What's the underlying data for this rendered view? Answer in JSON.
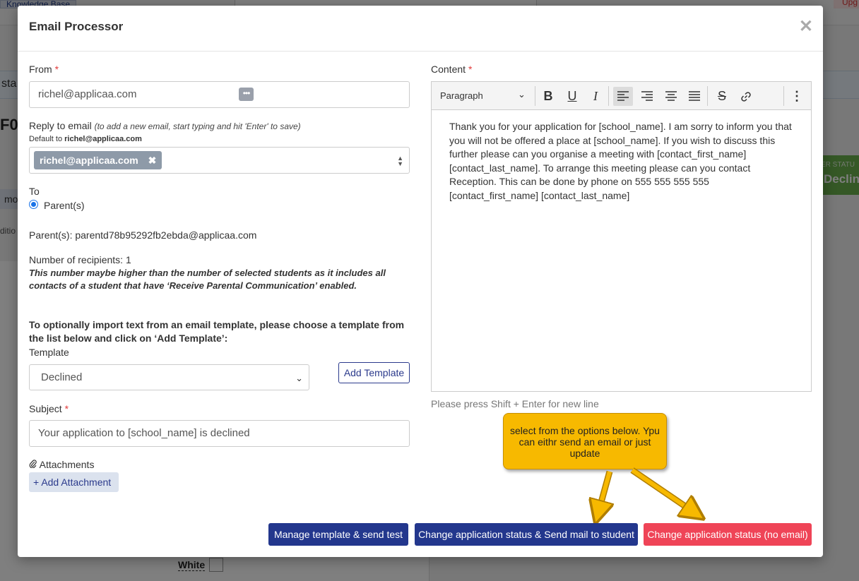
{
  "background": {
    "knowledge_base_tab": "Knowledge Base",
    "upgrade_tab": "Upg",
    "status_fragment": "sta",
    "title_fragment": "F0",
    "more_fragment": "mo",
    "additional_fragment": "ditio",
    "status_label_fragment": "ER STATU",
    "status_value_fragment": "Declin",
    "white_label": "White"
  },
  "modal": {
    "title": "Email Processor",
    "close_glyph": "✕",
    "from": {
      "label": "From",
      "required_mark": "*",
      "value": "richel@applicaa.com",
      "dots_glyph": "•••"
    },
    "reply_to": {
      "label": "Reply to email",
      "hint": "(to add a new email, start typing and hit 'Enter' to save)",
      "default_prefix": "Default to ",
      "default_email": "richel@applicaa.com",
      "chip": "richel@applicaa.com",
      "chip_remove": "✖"
    },
    "to": {
      "label": "To",
      "option": "Parent(s)"
    },
    "parents_line": "Parent(s): parentd78b95292fb2ebda@applicaa.com",
    "recipients": "Number of recipients: 1",
    "recipients_note": "This number maybe higher than the number of selected students as it includes all contacts of a student that have ‘Receive Parental Communication’ enabled.",
    "template_instructions": "To optionally import text from an email template, please choose a template from the list below and click on ‘Add Template’:",
    "template": {
      "label": "Template",
      "selected": "Declined",
      "add_button": "Add Template"
    },
    "subject": {
      "label": "Subject",
      "required_mark": "*",
      "value": "Your application to [school_name] is declined"
    },
    "attachments": {
      "label": "Attachments",
      "add_button": "Add Attachment"
    },
    "content": {
      "label": "Content",
      "required_mark": "*",
      "paragraph_style": "Paragraph",
      "body": "Thank you for your application for [school_name]. I am sorry to inform you that you will not be offered a place at [school_name]. If you wish to discuss this further please can you organise a meeting with [contact_first_name] [contact_last_name]. To arrange this meeting please can you contact Reception. This can be done by phone on 555 555 555 555 [contact_first_name] [contact_last_name]",
      "hint": "Please press Shift + Enter for new line"
    },
    "callout": "select from the options below. Ypu can eithr send an email or just update",
    "buttons": {
      "manage": "Manage template & send test",
      "change_send": "Change application status & Send mail to student",
      "change_only": "Change application status (no email)"
    }
  },
  "colors": {
    "navy": "#23378d",
    "red": "#ef4457",
    "callout": "#f7b900"
  }
}
